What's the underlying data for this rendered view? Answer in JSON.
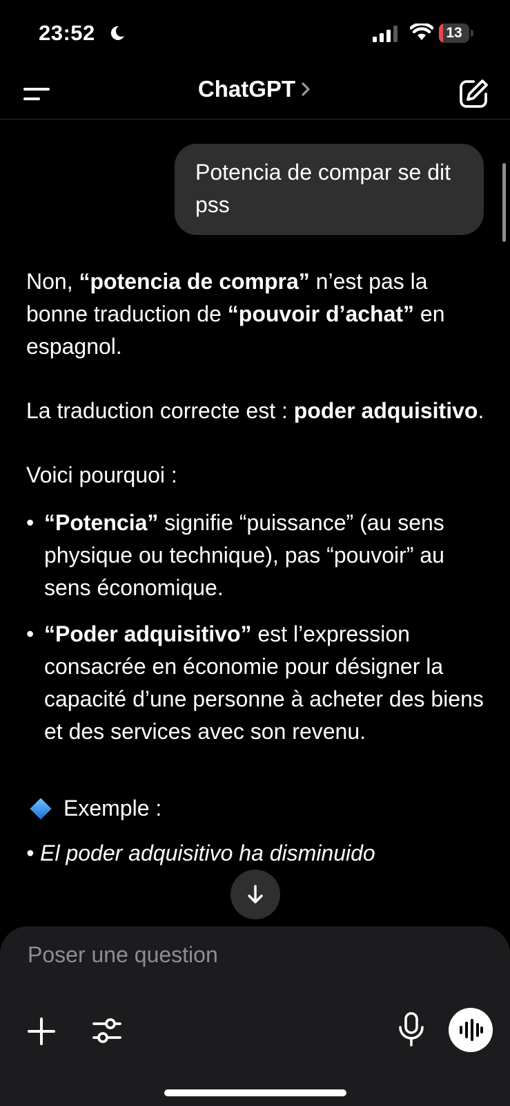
{
  "status_bar": {
    "time": "23:52",
    "battery_level": "13",
    "battery_fraction": 0.13,
    "icons": [
      "moon-icon",
      "signal-icon",
      "wifi-icon",
      "battery-icon"
    ]
  },
  "nav": {
    "title": "ChatGPT",
    "icons": [
      "menu-icon",
      "chevron-right-icon",
      "edit-icon"
    ]
  },
  "conversation": {
    "user_message": "Potencia de compar se dit pss",
    "answer": {
      "p1": [
        {
          "text": "Non, ",
          "bold": false
        },
        {
          "text": "“potencia de compra”",
          "bold": true
        },
        {
          "text": " n’est pas la bonne traduction de ",
          "bold": false
        },
        {
          "text": "“pouvoir d’achat”",
          "bold": true
        },
        {
          "text": " en espagnol.",
          "bold": false
        }
      ],
      "p2": [
        {
          "text": "La traduction correcte est : ",
          "bold": false
        },
        {
          "text": "poder adquisitivo",
          "bold": true
        },
        {
          "text": ".",
          "bold": false
        }
      ],
      "p3": "Voici pourquoi :",
      "bullets": [
        [
          {
            "text": "“Potencia”",
            "bold": true
          },
          {
            "text": " signifie “puissance” (au sens physique ou technique), pas “pouvoir” au sens économique.",
            "bold": false
          }
        ],
        [
          {
            "text": "“Poder adquisitivo”",
            "bold": true
          },
          {
            "text": " est l’expression consacrée en économie pour désigner la capacité d’une personne à acheter des biens et des services avec son revenu.",
            "bold": false
          }
        ]
      ],
      "bullet_marker": "•",
      "example_label": "Exemple :",
      "example_text": "El poder adquisitivo ha disminuido"
    }
  },
  "composer": {
    "placeholder": "Poser une question",
    "icons": [
      "plus-icon",
      "tools-icon",
      "mic-icon",
      "voice-mode-icon"
    ]
  },
  "colors": {
    "background": "#000000",
    "bubble": "#2f2f2f",
    "composer": "#1c1c1e",
    "battery_red": "#e5484d"
  }
}
